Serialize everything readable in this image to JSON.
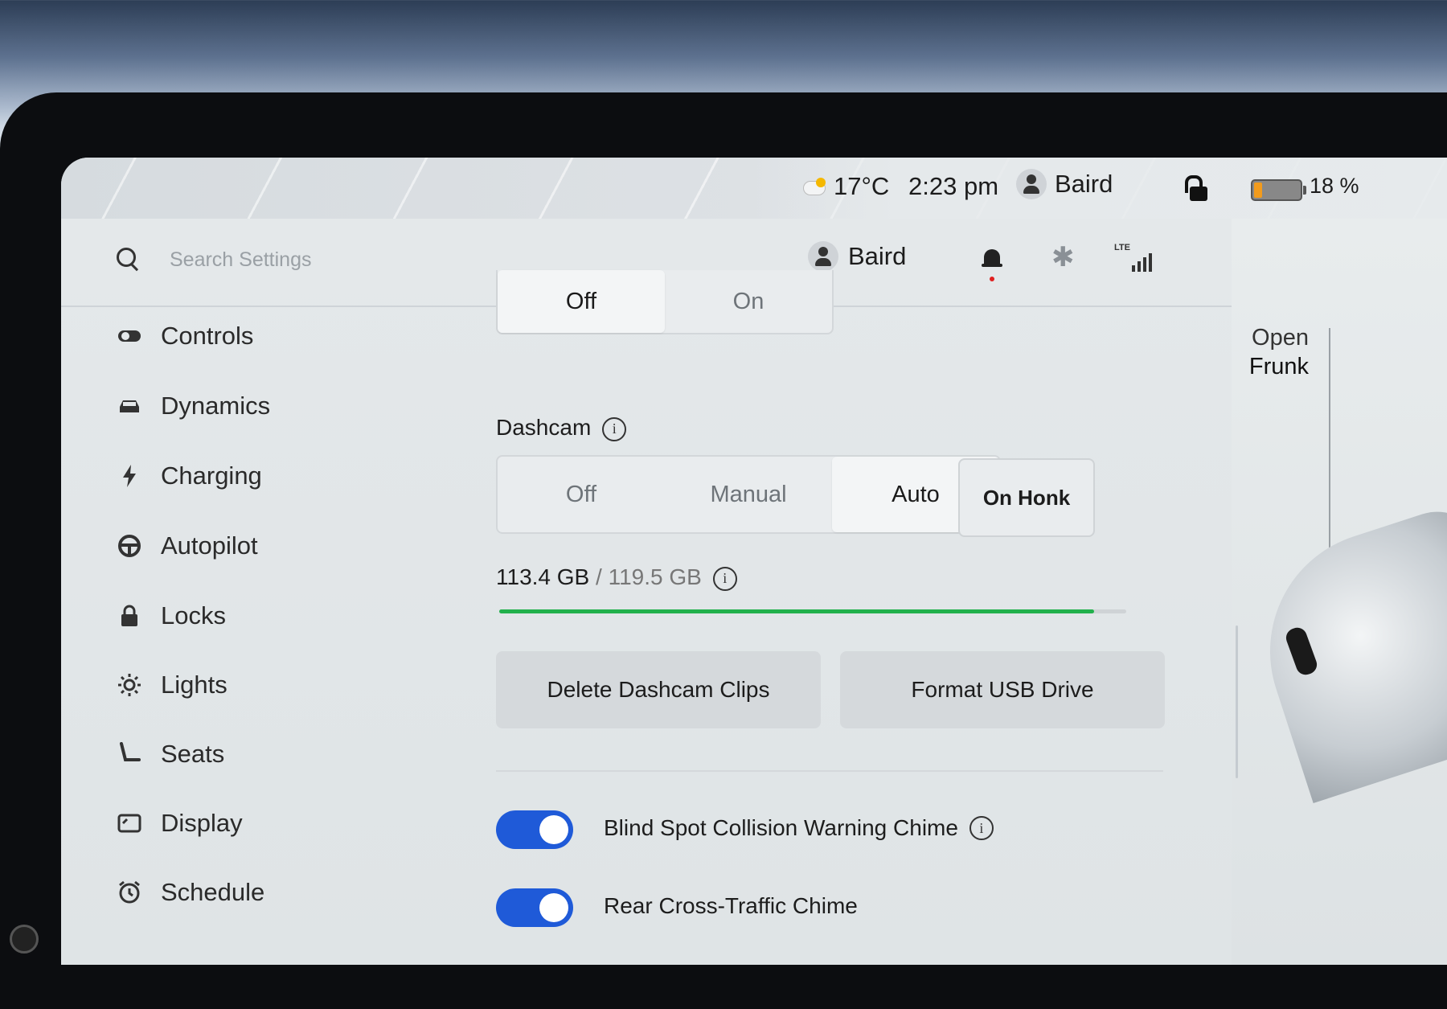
{
  "status_bar": {
    "temperature": "17°C",
    "time": "2:23 pm",
    "profile_name": "Baird",
    "battery_percent_label": "18 %",
    "battery_level": 0.18
  },
  "header": {
    "search_placeholder": "Search Settings",
    "profile_name": "Baird",
    "signal_label": "LTE"
  },
  "sidebar": {
    "items": [
      {
        "label": "Controls",
        "icon": "toggle-icon"
      },
      {
        "label": "Dynamics",
        "icon": "car-icon"
      },
      {
        "label": "Charging",
        "icon": "bolt-icon"
      },
      {
        "label": "Autopilot",
        "icon": "steering-wheel-icon"
      },
      {
        "label": "Locks",
        "icon": "lock-icon"
      },
      {
        "label": "Lights",
        "icon": "sun-icon"
      },
      {
        "label": "Seats",
        "icon": "seat-icon"
      },
      {
        "label": "Display",
        "icon": "display-icon"
      },
      {
        "label": "Schedule",
        "icon": "alarm-clock-icon"
      }
    ]
  },
  "main": {
    "top_toggle": {
      "options": [
        "Off",
        "On"
      ],
      "selected": "Off"
    },
    "dashcam": {
      "title": "Dashcam",
      "options": [
        "Off",
        "Manual",
        "Auto"
      ],
      "selected": "Auto",
      "on_honk_label": "On Honk"
    },
    "storage": {
      "used": "113.4 GB",
      "separator": " / ",
      "total": "119.5 GB",
      "used_fraction": 0.949
    },
    "buttons": {
      "delete_clips": "Delete Dashcam Clips",
      "format_usb": "Format USB Drive"
    },
    "chimes": [
      {
        "label": "Blind Spot Collision Warning Chime",
        "enabled": true,
        "has_info": true
      },
      {
        "label": "Rear Cross-Traffic Chime",
        "enabled": true,
        "has_info": false
      }
    ]
  },
  "car_panel": {
    "frunk_line1": "Open",
    "frunk_line2": "Frunk"
  },
  "colors": {
    "toggle_on": "#1f5ad8",
    "storage_bar": "#22b14c",
    "battery_fill": "#f29b1c",
    "notification_dot": "#e02020"
  }
}
